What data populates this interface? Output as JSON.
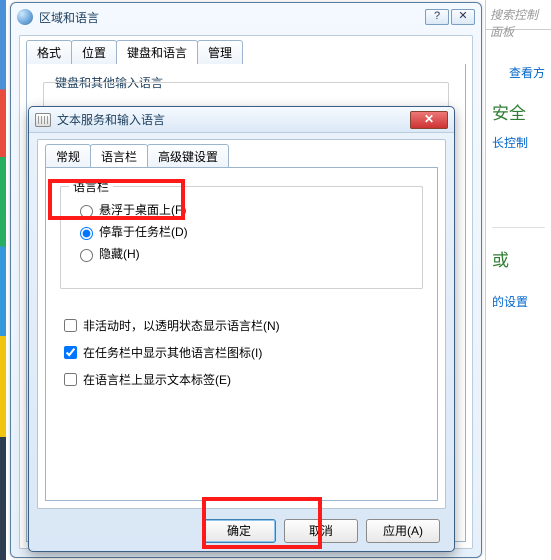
{
  "right": {
    "search_placeholder": "搜索控制面板",
    "view": "查看方",
    "section1": "安全",
    "link1": "长控制",
    "section2": "或",
    "alsolink": "的设置"
  },
  "back_dialog": {
    "title": "区域和语言",
    "tabs": {
      "format": "格式",
      "location": "位置",
      "keyboard": "键盘和语言",
      "admin": "管理"
    },
    "group_title": "键盘和其他输入语言"
  },
  "front_dialog": {
    "title": "文本服务和输入语言",
    "tabs": {
      "general": "常规",
      "langbar": "语言栏",
      "advkey": "高级键设置"
    },
    "group_title": "语言栏",
    "radios": {
      "float": "悬浮于桌面上(F)",
      "dock": "停靠于任务栏(D)",
      "hide": "隐藏(H)"
    },
    "checks": {
      "inactive": "非活动时，以透明状态显示语言栏(N)",
      "showicons": "在任务栏中显示其他语言栏图标(I)",
      "showtext": "在语言栏上显示文本标签(E)"
    },
    "buttons": {
      "ok": "确定",
      "cancel": "取消",
      "apply": "应用(A)"
    }
  }
}
